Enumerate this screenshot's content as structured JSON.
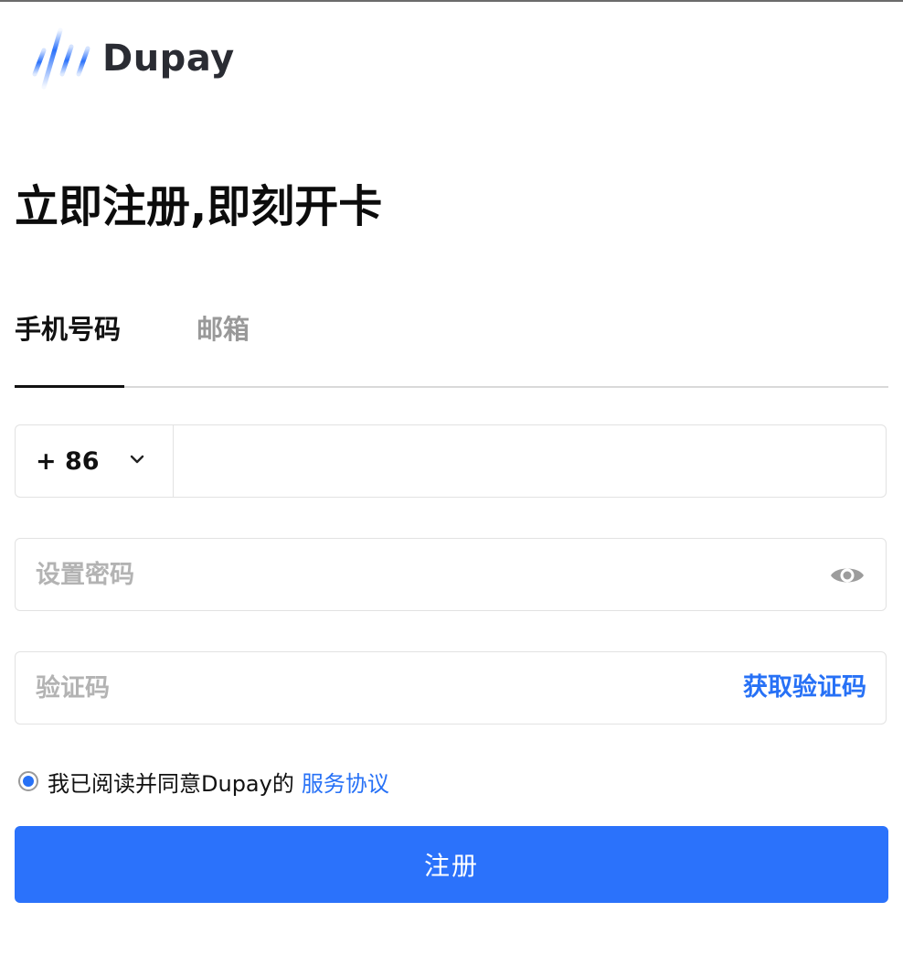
{
  "brand": {
    "name": "Dupay",
    "accent_color": "#2b72fb"
  },
  "page": {
    "title": "立即注册,即刻开卡"
  },
  "tabs": {
    "phone_label": "手机号码",
    "email_label": "邮箱",
    "active": "phone"
  },
  "phone": {
    "country_code": "+ 86",
    "dropdown_icon": "chevron-down-icon",
    "value": ""
  },
  "password": {
    "placeholder": "设置密码",
    "value": "",
    "toggle_icon": "eye-icon"
  },
  "verification": {
    "placeholder": "验证码",
    "value": "",
    "get_code_label": "获取验证码"
  },
  "agreement": {
    "checked": true,
    "text": "我已阅读并同意Dupay的",
    "link_label": "服务协议"
  },
  "submit": {
    "label": "注册"
  }
}
